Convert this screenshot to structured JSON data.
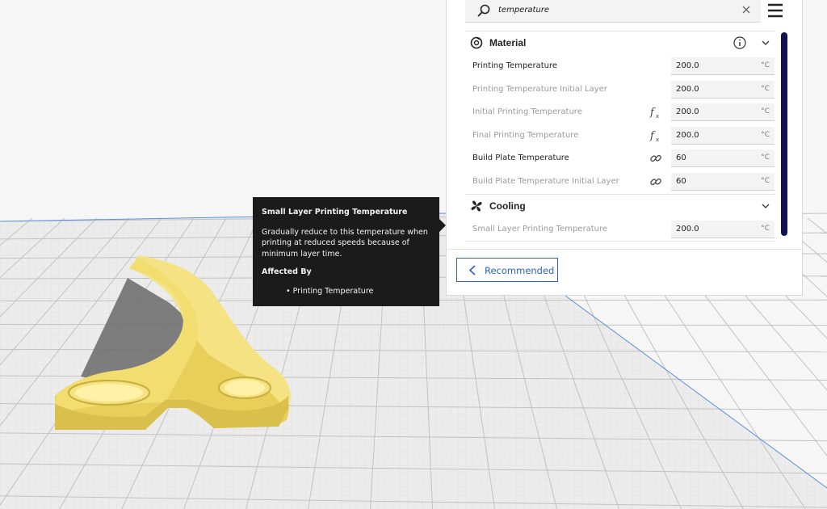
{
  "colors": {
    "accent": "#2a60c8",
    "scrollbar": "#101054",
    "model_fill": "#f2dd70",
    "tooltip_bg": "#1b1b1b"
  },
  "search": {
    "value": "temperature",
    "icon": "search-icon",
    "clear_icon": "close-icon"
  },
  "menu_icon": "hamburger-menu-icon",
  "categories": [
    {
      "label": "Material",
      "icon": "material-icon",
      "settings": [
        {
          "label": "Printing Temperature",
          "value": "200.0",
          "unit": "°C",
          "icon": ""
        },
        {
          "label": "Printing Temperature Initial Layer",
          "value": "200.0",
          "unit": "°C",
          "icon": ""
        },
        {
          "label": "Initial Printing Temperature",
          "value": "200.0",
          "unit": "°C",
          "icon": "function-icon"
        },
        {
          "label": "Final Printing Temperature",
          "value": "200.0",
          "unit": "°C",
          "icon": "function-icon"
        },
        {
          "label": "Build Plate Temperature",
          "value": "60",
          "unit": "°C",
          "icon": "link-icon"
        },
        {
          "label": "Build Plate Temperature Initial Layer",
          "value": "60",
          "unit": "°C",
          "icon": "link-icon"
        }
      ]
    },
    {
      "label": "Cooling",
      "icon": "fan-icon",
      "settings": [
        {
          "label": "Small Layer Printing Temperature",
          "value": "200.0",
          "unit": "°C",
          "icon": ""
        }
      ]
    }
  ],
  "recommended_button": "Recommended",
  "tooltip": {
    "title": "Small Layer Printing Temperature",
    "body": "Gradually reduce to this temperature when printing at reduced speeds because of minimum layer time.",
    "affected_by_label": "Affected By",
    "affected_item": "• Printing Temperature"
  }
}
